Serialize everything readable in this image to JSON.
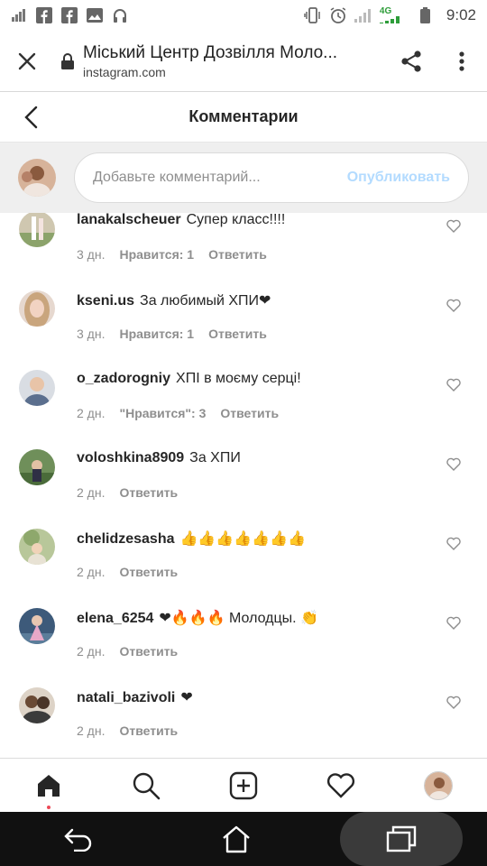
{
  "status_bar": {
    "time": "9:02",
    "network": "4G"
  },
  "browser": {
    "title": "Міський Центр Дозвілля Моло...",
    "url": "instagram.com"
  },
  "header": {
    "title": "Комментарии"
  },
  "composer": {
    "placeholder": "Добавьте комментарий...",
    "post_label": "Опубликовать"
  },
  "comments": [
    {
      "username": "lanakalscheuer",
      "text": "Супер класс!!!!",
      "time": "3 дн.",
      "likes": "Нравится: 1",
      "reply": "Ответить"
    },
    {
      "username": "kseni.us",
      "text": "За любимый ХПИ❤",
      "time": "3 дн.",
      "likes": "Нравится: 1",
      "reply": "Ответить"
    },
    {
      "username": "o_zadorogniy",
      "text": "ХПІ в моєму серці!",
      "time": "2 дн.",
      "likes": "\"Нравится\": 3",
      "reply": "Ответить"
    },
    {
      "username": "voloshkina8909",
      "text": "За ХПИ",
      "time": "2 дн.",
      "likes": "",
      "reply": "Ответить"
    },
    {
      "username": "chelidzesasha",
      "text": "👍👍👍👍👍👍👍",
      "time": "2 дн.",
      "likes": "",
      "reply": "Ответить"
    },
    {
      "username": "elena_6254",
      "text": "❤🔥🔥🔥 Молодцы. 👏",
      "time": "2 дн.",
      "likes": "",
      "reply": "Ответить"
    },
    {
      "username": "natali_bazivoli",
      "text": "❤",
      "time": "2 дн.",
      "likes": "",
      "reply": "Ответить"
    }
  ],
  "colors": {
    "accent_disabled": "#b3dbff",
    "like_heart": "#ed4956",
    "muted": "#8e8e8e"
  }
}
